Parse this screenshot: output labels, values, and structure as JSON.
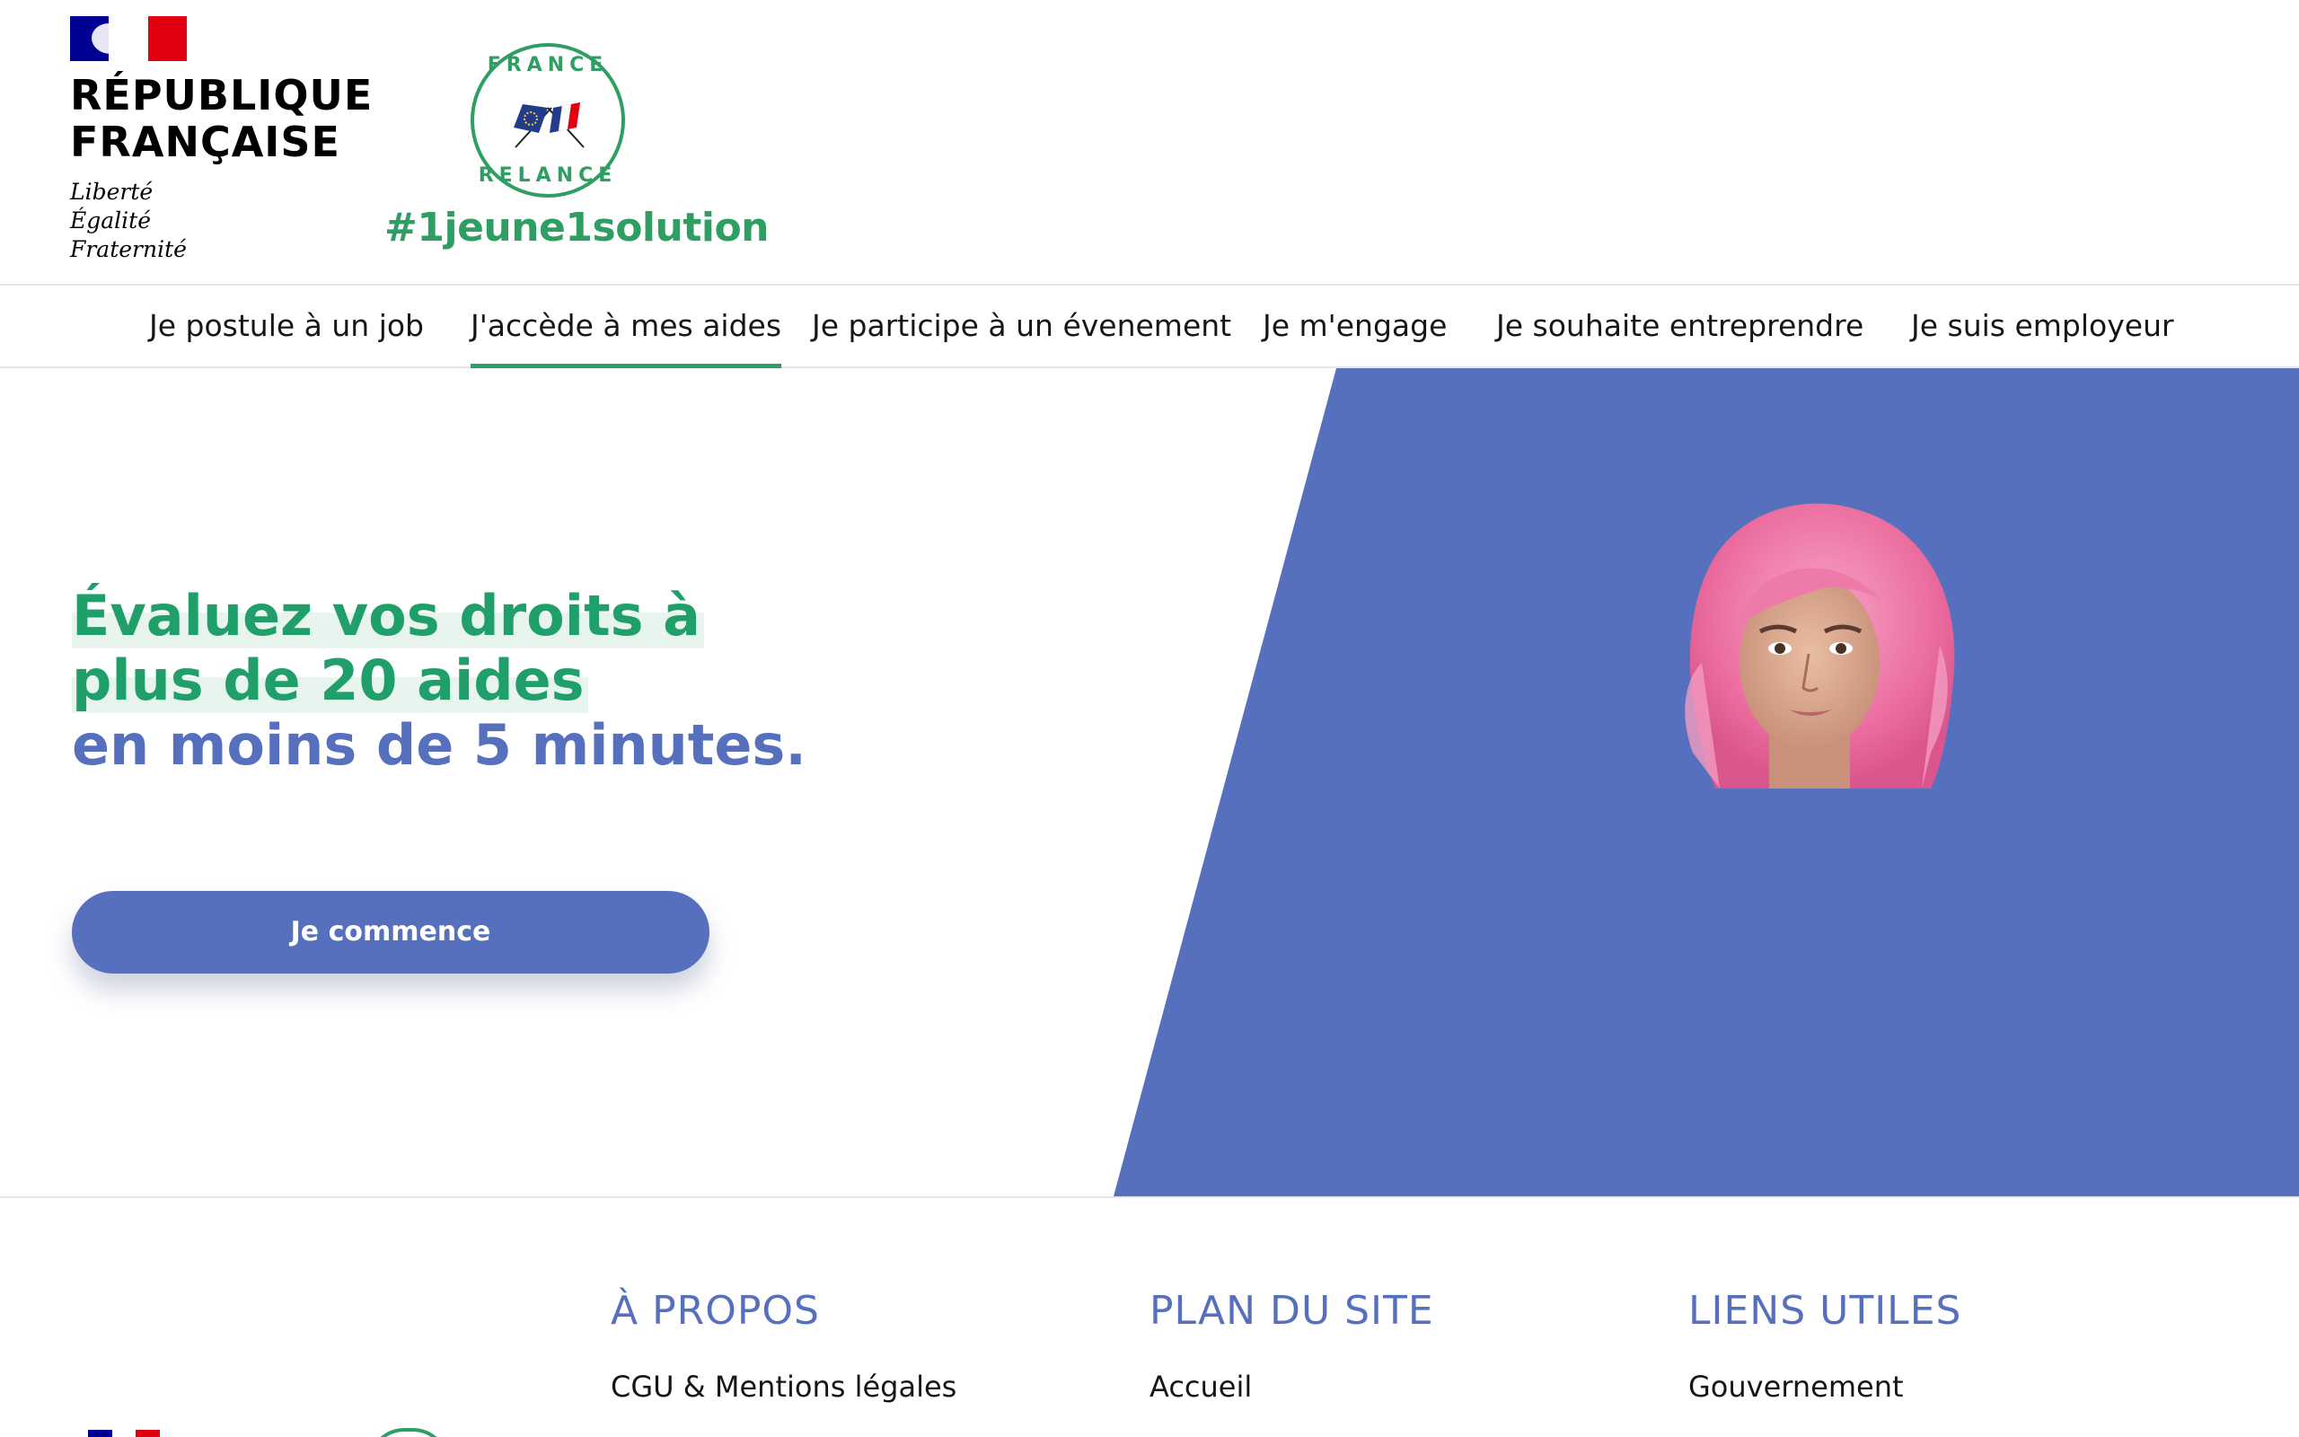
{
  "header": {
    "rf_title": [
      "RÉPUBLIQUE",
      "FRANÇAISE"
    ],
    "devise": [
      "Liberté",
      "Égalité",
      "Fraternité"
    ],
    "relance_badge": {
      "top": "FRANCE",
      "bottom": "RELANCE"
    },
    "hashtag": "#1jeune1solution"
  },
  "nav": {
    "items": [
      {
        "label": "Je postule à un job",
        "active": false
      },
      {
        "label": "J'accède à mes aides",
        "active": true
      },
      {
        "label": "Je participe à un évenement",
        "active": false
      },
      {
        "label": "Je m'engage",
        "active": false
      },
      {
        "label": "Je souhaite entreprendre",
        "active": false
      },
      {
        "label": "Je suis employeur",
        "active": false
      }
    ]
  },
  "hero": {
    "headline_green_1": "Évaluez vos droits à",
    "headline_green_2": "plus de 20 aides",
    "headline_blue": "en moins de 5 minutes.",
    "cta_label": "Je commence",
    "portrait_icon": "young-woman-pink-hair-portrait"
  },
  "footer": {
    "columns": [
      {
        "title": "À PROPOS",
        "links": [
          "CGU & Mentions légales"
        ]
      },
      {
        "title": "PLAN DU SITE",
        "links": [
          "Accueil"
        ]
      },
      {
        "title": "LIENS UTILES",
        "links": [
          "Gouvernement"
        ]
      }
    ]
  },
  "colors": {
    "brand_blue": "#5770be",
    "brand_green": "#219f6a",
    "relance_green": "#2e9e62",
    "flag_blue": "#000091",
    "flag_red": "#e1000f"
  }
}
